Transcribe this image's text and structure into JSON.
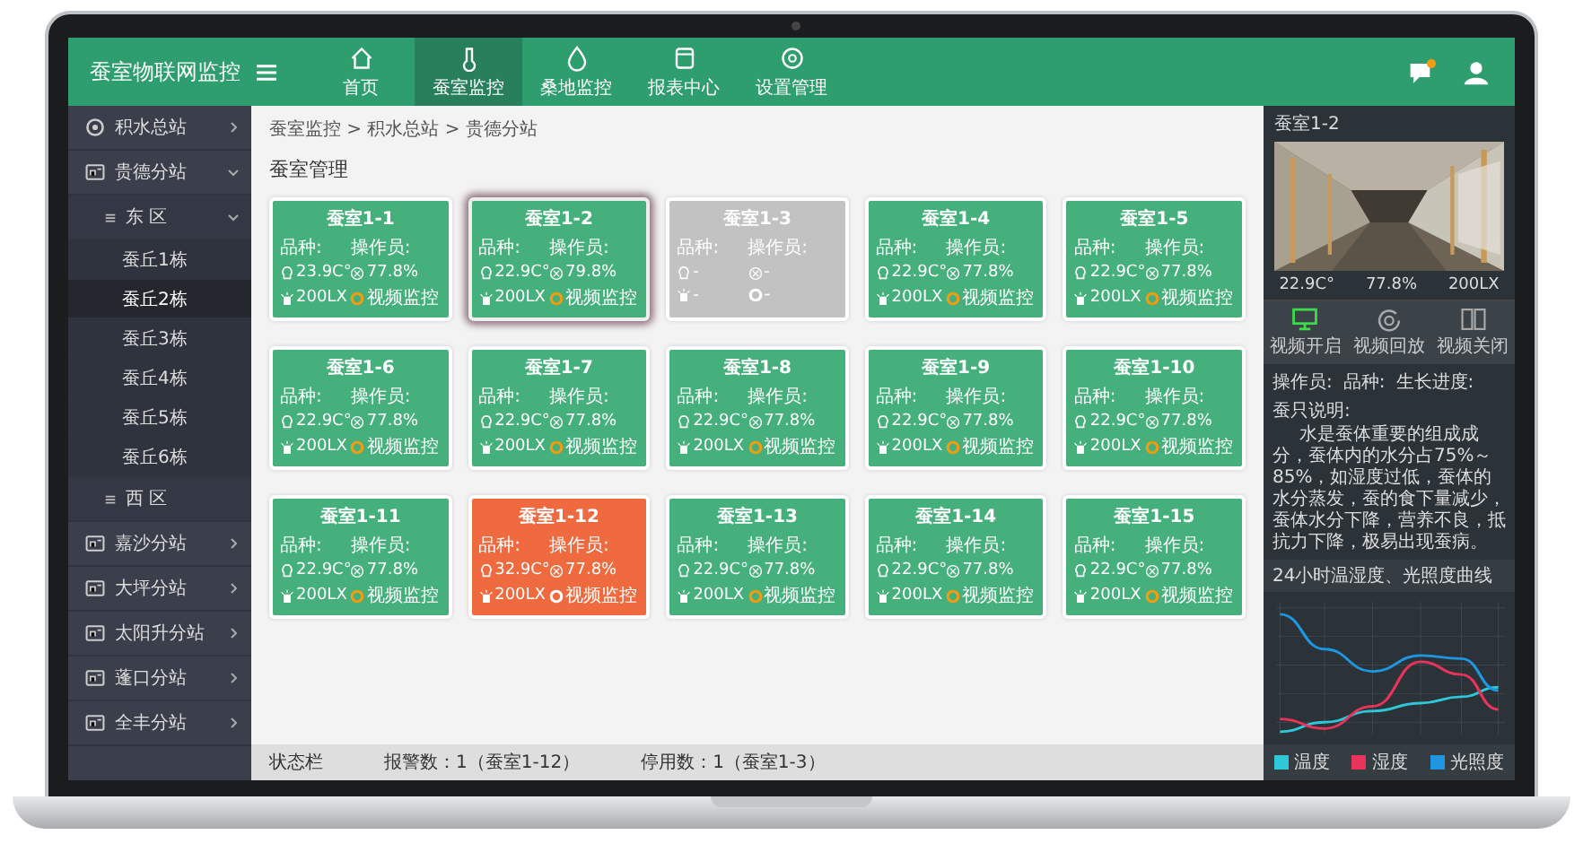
{
  "app": {
    "title": "蚕室物联网监控"
  },
  "nav": [
    {
      "label": "首页",
      "selected": false
    },
    {
      "label": "蚕室监控",
      "selected": true
    },
    {
      "label": "桑地监控",
      "selected": false
    },
    {
      "label": "报表中心",
      "selected": false
    },
    {
      "label": "设置管理",
      "selected": false
    }
  ],
  "sidebar": [
    {
      "label": "积水总站",
      "expanded": false,
      "selected": false
    },
    {
      "label": "贵德分站",
      "expanded": true,
      "selected": false,
      "children": [
        {
          "label": "东 区",
          "expanded": true,
          "selected": false,
          "children": [
            {
              "label": "蚕丘1栋",
              "selected": false
            },
            {
              "label": "蚕丘2栋",
              "selected": true
            },
            {
              "label": "蚕丘3栋",
              "selected": false
            },
            {
              "label": "蚕丘4栋",
              "selected": false
            },
            {
              "label": "蚕丘5栋",
              "selected": false
            },
            {
              "label": "蚕丘6栋",
              "selected": false
            }
          ]
        },
        {
          "label": "西 区",
          "selected": false
        }
      ]
    },
    {
      "label": "嘉沙分站",
      "expanded": false,
      "selected": false
    },
    {
      "label": "大坪分站",
      "expanded": false,
      "selected": false
    },
    {
      "label": "太阳升分站",
      "expanded": false,
      "selected": false
    },
    {
      "label": "蓬口分站",
      "expanded": false,
      "selected": false
    },
    {
      "label": "全丰分站",
      "expanded": false,
      "selected": false
    }
  ],
  "breadcrumb": "蚕室监控 > 积水总站 > 贵德分站",
  "page_title": "蚕室管理",
  "rooms": [
    {
      "title": "蚕室1-1",
      "variety": "品种:",
      "operator": "操作员:",
      "temperature": "23.9C°",
      "humidity": "77.8%",
      "light": "200LX",
      "video": "视频监控",
      "kind": "normal",
      "selected": false
    },
    {
      "title": "蚕室1-2",
      "variety": "品种:",
      "operator": "操作员:",
      "temperature": "22.9C°",
      "humidity": "79.8%",
      "light": "200LX",
      "video": "视频监控",
      "kind": "normal",
      "selected": true
    },
    {
      "title": "蚕室1-3",
      "variety": "品种:",
      "operator": "操作员:",
      "temperature": "-",
      "humidity": "-",
      "light": "-",
      "video": "-",
      "kind": "disabled",
      "selected": false
    },
    {
      "title": "蚕室1-4",
      "variety": "品种:",
      "operator": "操作员:",
      "temperature": "22.9C°",
      "humidity": "77.8%",
      "light": "200LX",
      "video": "视频监控",
      "kind": "normal",
      "selected": false
    },
    {
      "title": "蚕室1-5",
      "variety": "品种:",
      "operator": "操作员:",
      "temperature": "22.9C°",
      "humidity": "77.8%",
      "light": "200LX",
      "video": "视频监控",
      "kind": "normal",
      "selected": false
    },
    {
      "title": "蚕室1-6",
      "variety": "品种:",
      "operator": "操作员:",
      "temperature": "22.9C°",
      "humidity": "77.8%",
      "light": "200LX",
      "video": "视频监控",
      "kind": "normal",
      "selected": false
    },
    {
      "title": "蚕室1-7",
      "variety": "品种:",
      "operator": "操作员:",
      "temperature": "22.9C°",
      "humidity": "77.8%",
      "light": "200LX",
      "video": "视频监控",
      "kind": "normal",
      "selected": false
    },
    {
      "title": "蚕室1-8",
      "variety": "品种:",
      "operator": "操作员:",
      "temperature": "22.9C°",
      "humidity": "77.8%",
      "light": "200LX",
      "video": "视频监控",
      "kind": "normal",
      "selected": false
    },
    {
      "title": "蚕室1-9",
      "variety": "品种:",
      "operator": "操作员:",
      "temperature": "22.9C°",
      "humidity": "77.8%",
      "light": "200LX",
      "video": "视频监控",
      "kind": "normal",
      "selected": false
    },
    {
      "title": "蚕室1-10",
      "variety": "品种:",
      "operator": "操作员:",
      "temperature": "22.9C°",
      "humidity": "77.8%",
      "light": "200LX",
      "video": "视频监控",
      "kind": "normal",
      "selected": false
    },
    {
      "title": "蚕室1-11",
      "variety": "品种:",
      "operator": "操作员:",
      "temperature": "22.9C°",
      "humidity": "77.8%",
      "light": "200LX",
      "video": "视频监控",
      "kind": "normal",
      "selected": false
    },
    {
      "title": "蚕室1-12",
      "variety": "品种:",
      "operator": "操作员:",
      "temperature": "32.9C°",
      "humidity": "77.8%",
      "light": "200LX",
      "video": "视频监控",
      "kind": "alarm",
      "selected": false
    },
    {
      "title": "蚕室1-13",
      "variety": "品种:",
      "operator": "操作员:",
      "temperature": "22.9C°",
      "humidity": "77.8%",
      "light": "200LX",
      "video": "视频监控",
      "kind": "normal",
      "selected": false
    },
    {
      "title": "蚕室1-14",
      "variety": "品种:",
      "operator": "操作员:",
      "temperature": "22.9C°",
      "humidity": "77.8%",
      "light": "200LX",
      "video": "视频监控",
      "kind": "normal",
      "selected": false
    },
    {
      "title": "蚕室1-15",
      "variety": "品种:",
      "operator": "操作员:",
      "temperature": "22.9C°",
      "humidity": "77.8%",
      "light": "200LX",
      "video": "视频监控",
      "kind": "normal",
      "selected": false
    }
  ],
  "status_bar": {
    "label": "状态栏",
    "alarms": "报警数：1（蚕室1-12）",
    "disabled": "停用数：1（蚕室1-3）"
  },
  "detail": {
    "title": "蚕室1-2",
    "temperature": "22.9C°",
    "humidity": "77.8%",
    "light": "200LX",
    "actions": [
      {
        "label": "视频开启",
        "on": true
      },
      {
        "label": "视频回放",
        "on": false
      },
      {
        "label": "视频关闭",
        "on": false
      }
    ],
    "operator": "操作员:",
    "variety": "品种:",
    "progress": "生长进度:",
    "note_title": "蚕只说明:",
    "note": "水是蚕体重要的组成成分，蚕体内的水分占75%～85%，如湿度过低，蚕体的水分蒸发，蚕的食下量减少，蚕体水分下降，营养不良，抵抗力下降，极易出现蚕病。",
    "chart_title": "24小时温湿度、光照度曲线",
    "legend": [
      {
        "label": "温度",
        "color": "#2ec8d8"
      },
      {
        "label": "湿度",
        "color": "#e8335a"
      },
      {
        "label": "光照度",
        "color": "#1e96e0"
      }
    ]
  }
}
